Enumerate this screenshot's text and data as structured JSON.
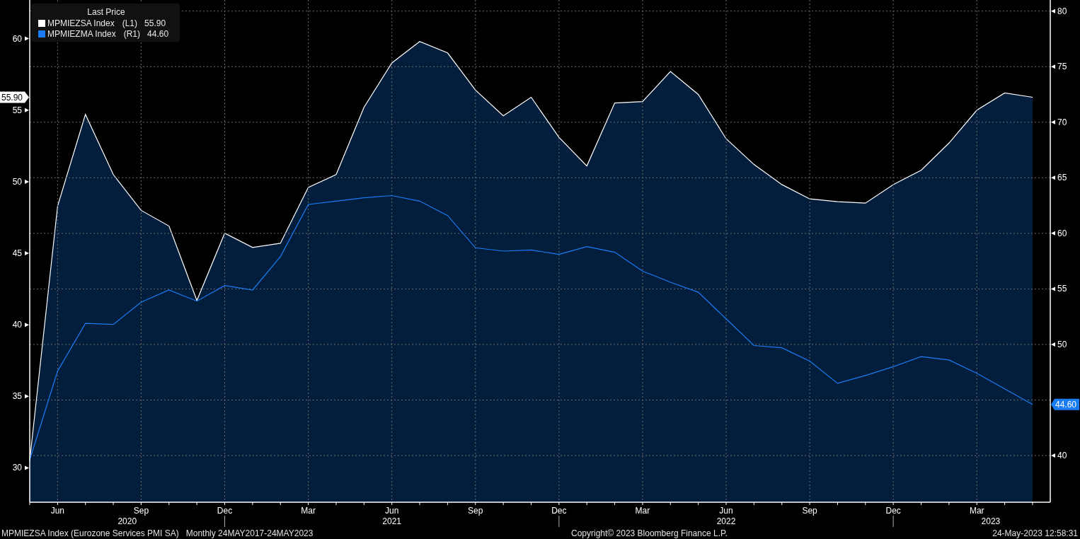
{
  "chart_data": {
    "type": "area",
    "grid": true,
    "legend": {
      "title": "Last Price"
    },
    "categories": [
      null,
      "Jun",
      null,
      null,
      "Sep",
      null,
      null,
      "Dec",
      null,
      null,
      "Mar",
      null,
      null,
      "Jun",
      null,
      null,
      "Sep",
      null,
      null,
      "Dec",
      null,
      null,
      "Mar",
      null,
      null,
      "Jun",
      null,
      null,
      "Sep",
      null,
      null,
      "Dec",
      null,
      null,
      "Mar",
      null,
      null
    ],
    "series": [
      {
        "name": "MPMIEZSA Index",
        "color": "#ffffff",
        "type": "area",
        "values": [
          30.5,
          48.3,
          54.7,
          50.5,
          48.0,
          46.9,
          41.7,
          46.4,
          45.4,
          45.7,
          49.6,
          50.5,
          55.2,
          58.3,
          59.8,
          59.0,
          56.4,
          54.6,
          55.9,
          53.1,
          51.1,
          55.5,
          55.6,
          57.7,
          56.1,
          53.0,
          51.2,
          49.8,
          48.8,
          48.6,
          48.5,
          49.8,
          50.8,
          52.7,
          55.0,
          56.2,
          55.9
        ]
      },
      {
        "name": "MPMIEZMA Index",
        "color": "#1a7cf5",
        "type": "line",
        "axis": "y2",
        "values": [
          39.6,
          47.6,
          51.9,
          51.8,
          53.8,
          54.9,
          53.9,
          55.3,
          54.9,
          57.9,
          62.6,
          62.9,
          63.2,
          63.4,
          62.9,
          61.6,
          58.7,
          58.4,
          58.5,
          58.1,
          58.8,
          58.3,
          56.6,
          55.6,
          54.7,
          52.3,
          49.9,
          49.7,
          48.5,
          46.5,
          47.2,
          48.0,
          48.9,
          48.6,
          47.4,
          46.0,
          44.6
        ]
      }
    ],
    "ylim": [
      27.6,
      62.7
    ],
    "yticks": [
      30,
      35,
      40,
      45,
      50,
      55,
      60
    ],
    "y2lim": [
      35.8,
      81.0
    ],
    "y2ticks": [
      40,
      50,
      55,
      60,
      65,
      70,
      75,
      80
    ]
  },
  "legend_rows": [
    {
      "axis": "(L1)",
      "value": "55.90"
    },
    {
      "axis": "(R1)",
      "value": "44.60"
    }
  ],
  "year_labels": [
    "2020",
    "2021",
    "2022",
    "2023"
  ],
  "value_tags": [
    "55.90",
    "44.60"
  ],
  "footer": {
    "left": [
      "MPMIEZSA Index (Eurozone Services PMI SA)",
      "Monthly 24MAY2017-24MAY2023"
    ],
    "center": "Copyright© 2023 Bloomberg Finance L.P.",
    "right": "24-May-2023 12:58:31"
  }
}
